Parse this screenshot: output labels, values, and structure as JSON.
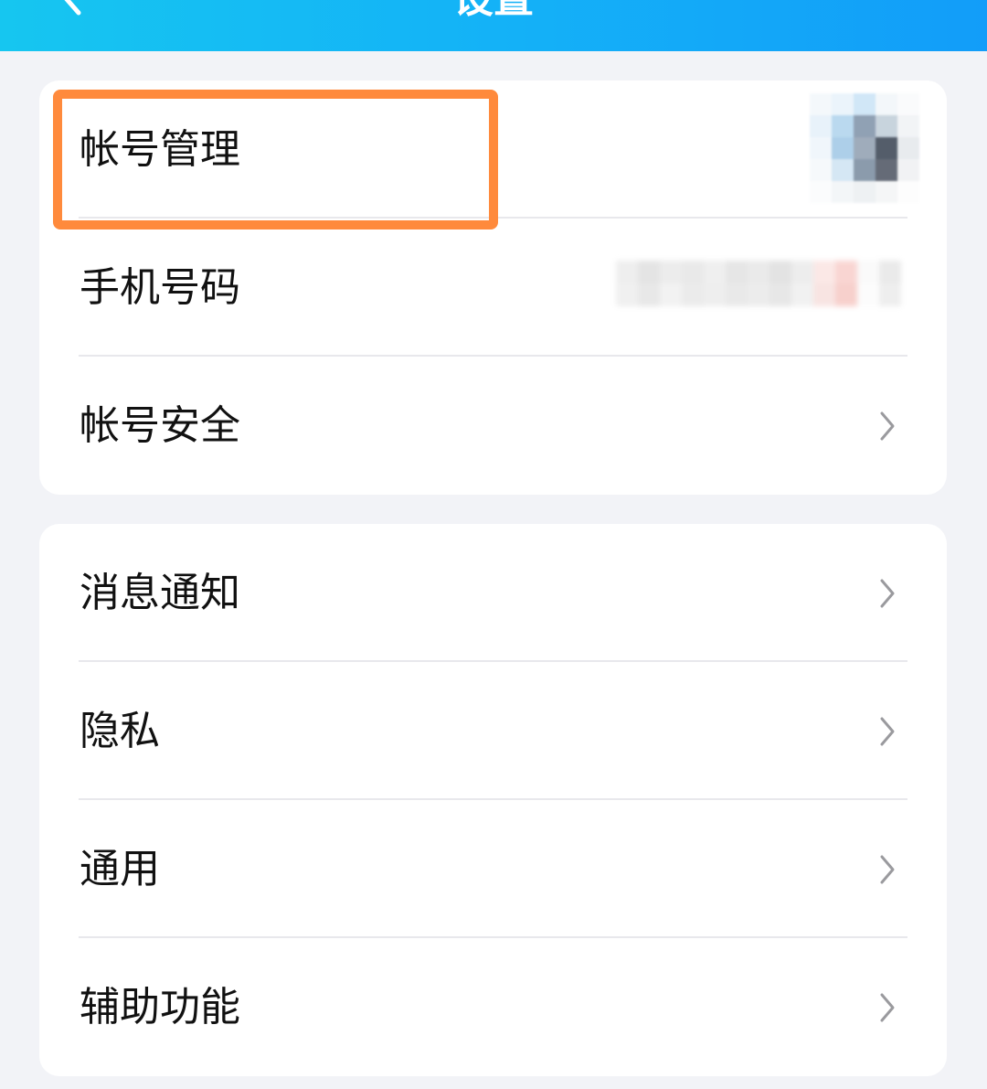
{
  "header": {
    "title": "设置",
    "back_icon": "chevron-left-icon",
    "gradient": [
      "#16c6f0",
      "#129df9"
    ]
  },
  "groups": [
    {
      "items": [
        {
          "label": "帐号管理",
          "trailing": "avatar"
        },
        {
          "label": "手机号码",
          "trailing": "masked-value"
        },
        {
          "label": "帐号安全",
          "trailing": "chevron-right-icon"
        }
      ]
    },
    {
      "items": [
        {
          "label": "消息通知",
          "trailing": "chevron-right-icon"
        },
        {
          "label": "隐私",
          "trailing": "chevron-right-icon"
        },
        {
          "label": "通用",
          "trailing": "chevron-right-icon"
        },
        {
          "label": "辅助功能",
          "trailing": "chevron-right-icon"
        }
      ]
    }
  ],
  "highlight": {
    "target": "帐号管理",
    "color": "#ff8a3c"
  },
  "colors": {
    "background": "#f2f3f7",
    "card": "#ffffff",
    "text": "#111111",
    "chevron": "#9a9a9e",
    "divider": "#e8e8ec"
  }
}
